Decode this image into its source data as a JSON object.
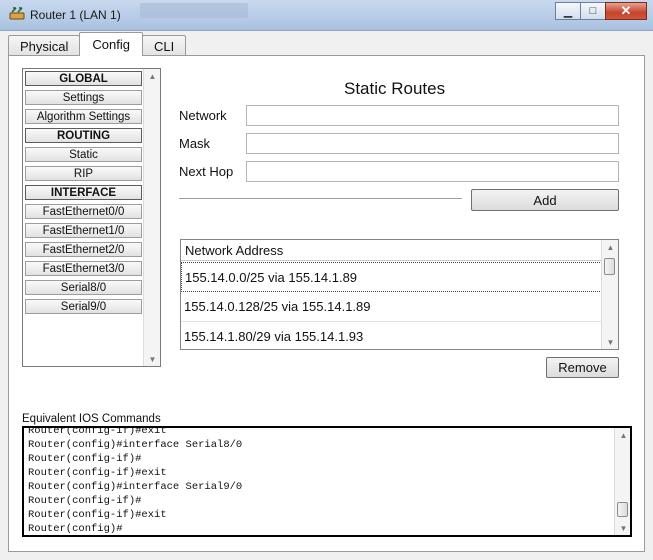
{
  "window": {
    "title": "Router 1 (LAN 1)",
    "minimize_glyph": "▁",
    "maximize_glyph": "□",
    "close_glyph": "✕"
  },
  "tabs": [
    {
      "label": "Physical",
      "active": false
    },
    {
      "label": "Config",
      "active": true
    },
    {
      "label": "CLI",
      "active": false
    }
  ],
  "sidebar": {
    "items": [
      {
        "label": "GLOBAL",
        "type": "header"
      },
      {
        "label": "Settings",
        "type": "item"
      },
      {
        "label": "Algorithm Settings",
        "type": "item"
      },
      {
        "label": "ROUTING",
        "type": "header"
      },
      {
        "label": "Static",
        "type": "item"
      },
      {
        "label": "RIP",
        "type": "item"
      },
      {
        "label": "INTERFACE",
        "type": "header"
      },
      {
        "label": "FastEthernet0/0",
        "type": "item"
      },
      {
        "label": "FastEthernet1/0",
        "type": "item"
      },
      {
        "label": "FastEthernet2/0",
        "type": "item"
      },
      {
        "label": "FastEthernet3/0",
        "type": "item"
      },
      {
        "label": "Serial8/0",
        "type": "item"
      },
      {
        "label": "Serial9/0",
        "type": "item"
      }
    ]
  },
  "static_routes": {
    "title": "Static Routes",
    "network_label": "Network",
    "network_value": "",
    "mask_label": "Mask",
    "mask_value": "",
    "next_hop_label": "Next Hop",
    "next_hop_value": "",
    "add_label": "Add",
    "list_header": "Network Address",
    "routes": [
      "155.14.0.0/25 via 155.14.1.89",
      "155.14.0.128/25 via 155.14.1.89",
      "155.14.1.80/29 via 155.14.1.93"
    ],
    "remove_label": "Remove"
  },
  "ios": {
    "label": "Equivalent IOS Commands",
    "lines": [
      "Router(config-if)#exit",
      "Router(config)#interface Serial8/0",
      "Router(config-if)#",
      "Router(config-if)#exit",
      "Router(config)#interface Serial9/0",
      "Router(config-if)#",
      "Router(config-if)#exit",
      "Router(config)#"
    ]
  },
  "icons": {
    "app": "router-app-icon",
    "scroll_up": "scroll-up-arrow-icon",
    "scroll_down": "scroll-down-arrow-icon"
  },
  "colors": {
    "titlebar": "#b6cbe6",
    "close_button": "#c4442c",
    "panel_background": "#ffffff"
  }
}
